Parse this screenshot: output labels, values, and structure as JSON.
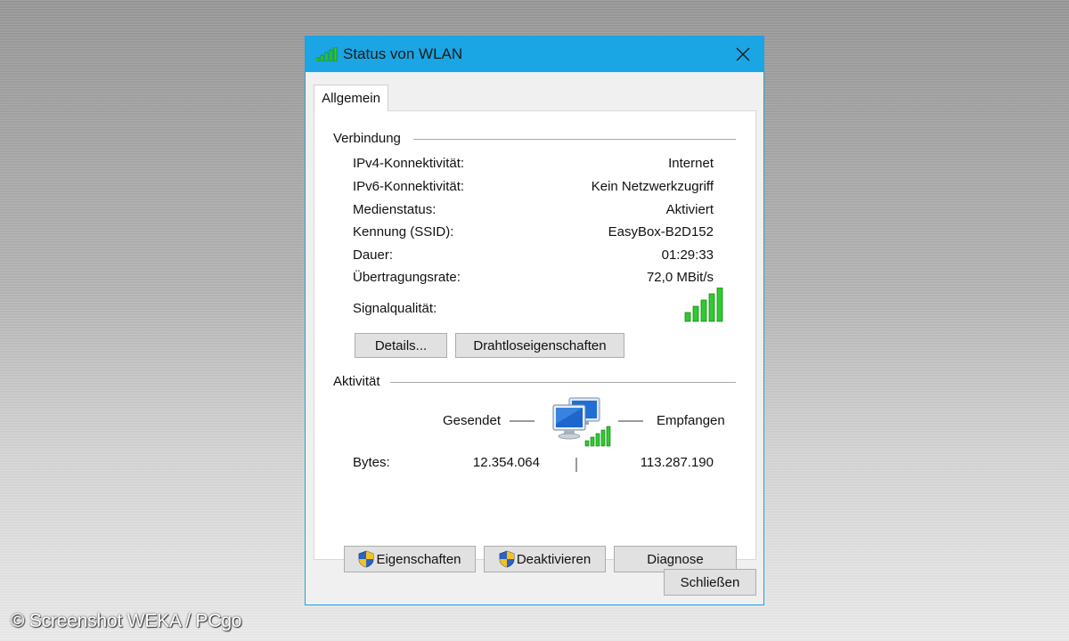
{
  "window": {
    "title": "Status von WLAN",
    "close_glyph": "✕"
  },
  "tabs": [
    {
      "label": "Allgemein",
      "selected": true
    }
  ],
  "connection": {
    "heading": "Verbindung",
    "rows": [
      {
        "label": "IPv4-Konnektivität:",
        "value": "Internet"
      },
      {
        "label": "IPv6-Konnektivität:",
        "value": "Kein Netzwerkzugriff"
      },
      {
        "label": "Medienstatus:",
        "value": "Aktiviert"
      },
      {
        "label": "Kennung (SSID):",
        "value": "EasyBox-B2D152"
      },
      {
        "label": "Dauer:",
        "value": "01:29:33"
      },
      {
        "label": "Übertragungsrate:",
        "value": "72,0 MBit/s"
      }
    ],
    "signal_label": "Signalqualität:",
    "signal_bars": 5,
    "signal_bars_max": 5,
    "details_button": "Details...",
    "wireless_props_button": "Drahtloseigenschaften"
  },
  "activity": {
    "heading": "Aktivität",
    "sent_label": "Gesendet",
    "received_label": "Empfangen",
    "bytes_label": "Bytes:",
    "bytes_sent": "12.354.064",
    "bytes_received": "113.287.190",
    "network_icon": "network-computers-icon"
  },
  "actions": {
    "properties_button": "Eigenschaften",
    "disable_button": "Deaktivieren",
    "diagnose_button": "Diagnose",
    "shield_icon": "uac-shield-icon"
  },
  "footer": {
    "close_button": "Schließen"
  },
  "credit": "© Screenshot WEKA / PCgo",
  "colors": {
    "titlebar": "#1aa6e4",
    "signal_green": "#2ecc2e",
    "button_face": "#e1e1e1",
    "dialog_bg": "#f0f0f0"
  }
}
